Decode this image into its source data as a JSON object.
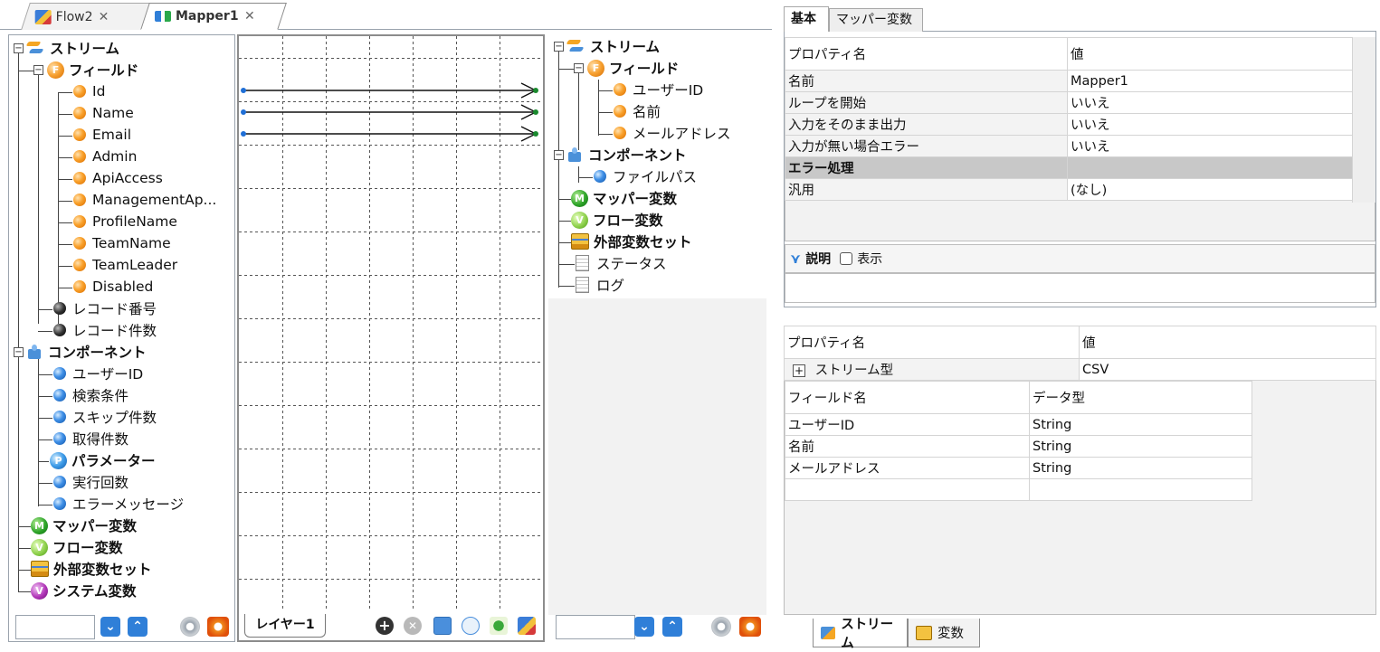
{
  "editor_tabs": [
    {
      "label": "Flow2",
      "close": "✕"
    },
    {
      "label": "Mapper1",
      "close": "✕"
    }
  ],
  "left_tree": {
    "stream": "ストリーム",
    "fields": "フィールド",
    "field_items": [
      "Id",
      "Name",
      "Email",
      "Admin",
      "ApiAccess",
      "ManagementAp...",
      "ProfileName",
      "TeamName",
      "TeamLeader",
      "Disabled"
    ],
    "record_number": "レコード番号",
    "record_count": "レコード件数",
    "component": "コンポーネント",
    "component_items": [
      "ユーザーID",
      "検索条件",
      "スキップ件数",
      "取得件数"
    ],
    "parameter": "パラメーター",
    "component_items2": [
      "実行回数",
      "エラーメッセージ"
    ],
    "mapper_vars": "マッパー変数",
    "flow_vars": "フロー変数",
    "ext_var_set": "外部変数セット",
    "system_vars": "システム変数"
  },
  "right_tree": {
    "stream": "ストリーム",
    "fields": "フィールド",
    "field_items": [
      "ユーザーID",
      "名前",
      "メールアドレス"
    ],
    "component": "コンポーネント",
    "component_items": [
      "ファイルパス"
    ],
    "mapper_vars": "マッパー変数",
    "flow_vars": "フロー変数",
    "ext_var_set": "外部変数セット",
    "status": "ステータス",
    "log": "ログ"
  },
  "center": {
    "layer_tab": "レイヤー1"
  },
  "props_panel": {
    "tabs": [
      "基本",
      "マッパー変数"
    ],
    "header": {
      "name": "プロパティ名",
      "value": "値"
    },
    "rows": [
      {
        "name": "名前",
        "value": "Mapper1"
      },
      {
        "name": "ループを開始",
        "value": "いいえ"
      },
      {
        "name": "入力をそのまま出力",
        "value": "いいえ"
      },
      {
        "name": "入力が無い場合エラー",
        "value": "いいえ"
      }
    ],
    "group": "エラー処理",
    "group_rows": [
      {
        "name": "汎用",
        "value": "(なし)"
      }
    ],
    "description_label": "説明",
    "show_label": "表示"
  },
  "stream_panel": {
    "header": {
      "name": "プロパティ名",
      "value": "値"
    },
    "stream_type_label": "ストリーム型",
    "stream_type_value": "CSV",
    "field_header": {
      "name": "フィールド名",
      "type": "データ型"
    },
    "fields": [
      {
        "name": "ユーザーID",
        "type": "String"
      },
      {
        "name": "名前",
        "type": "String"
      },
      {
        "name": "メールアドレス",
        "type": "String"
      }
    ],
    "bottom_tabs": [
      "ストリーム",
      "変数"
    ]
  }
}
